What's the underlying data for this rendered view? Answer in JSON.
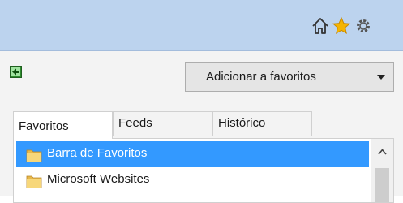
{
  "toolbar": {
    "icons": [
      "home-icon",
      "favorites-star-icon",
      "gear-icon"
    ],
    "background_color": "#bcd3ee"
  },
  "favorites_center": {
    "pin_icon": "pin-favorites-center-icon",
    "add_button_label": "Adicionar a favoritos",
    "tabs": [
      {
        "label": "Favoritos",
        "selected": true
      },
      {
        "label": "Feeds",
        "selected": false
      },
      {
        "label": "Histórico",
        "selected": false
      }
    ],
    "items": [
      {
        "label": "Barra de Favoritos",
        "icon": "folder-icon",
        "selected": true
      },
      {
        "label": "Microsoft Websites",
        "icon": "folder-icon",
        "selected": false
      }
    ],
    "selection_color": "#3399ff"
  }
}
